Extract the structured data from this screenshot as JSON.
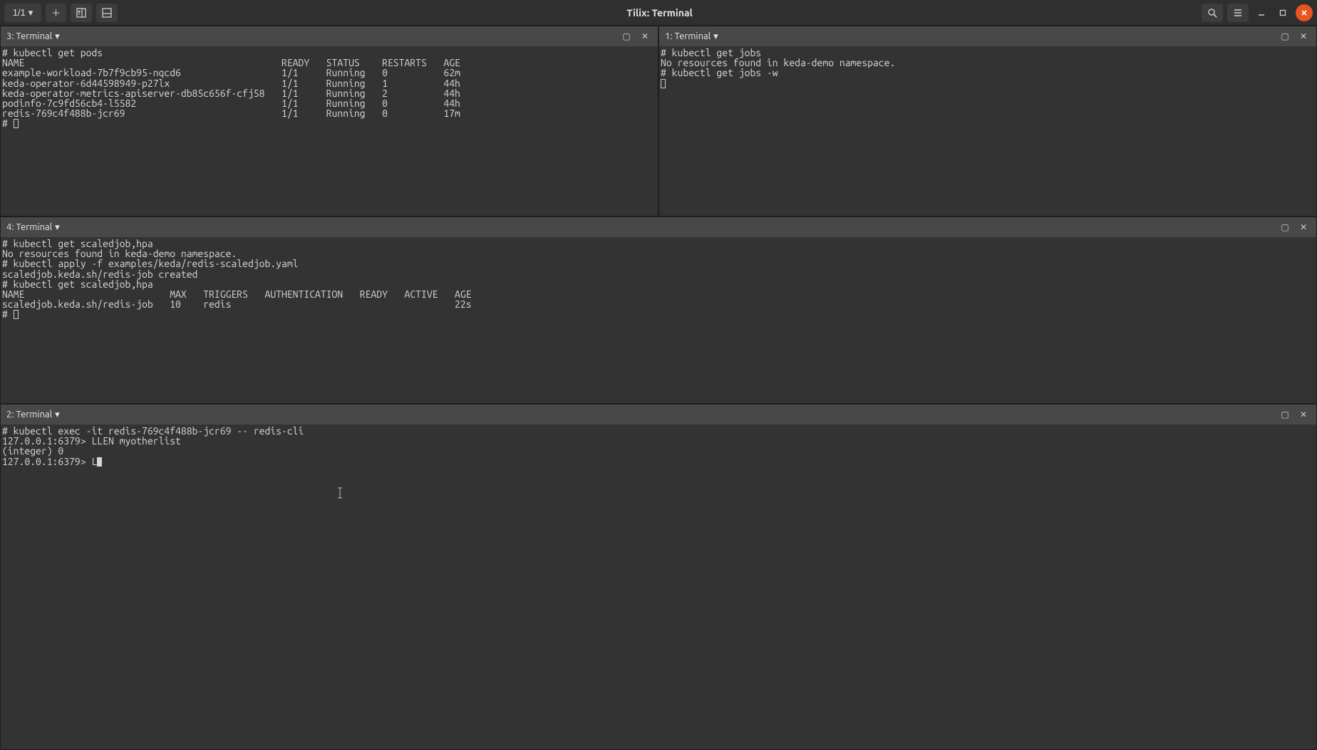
{
  "titlebar": {
    "session_label": "1/1",
    "title": "Tilix: Terminal"
  },
  "panes": {
    "p3": {
      "label": "3: Terminal"
    },
    "p1": {
      "label": "1: Terminal"
    },
    "p4": {
      "label": "4: Terminal"
    },
    "p2": {
      "label": "2: Terminal"
    }
  },
  "term3": {
    "cmd": "# kubectl get pods",
    "hdr": "NAME                                              READY   STATUS    RESTARTS   AGE",
    "r1": "example-workload-7b7f9cb95-nqcd6                  1/1     Running   0          62m",
    "r2": "keda-operator-6d44598949-p27lx                    1/1     Running   1          44h",
    "r3": "keda-operator-metrics-apiserver-db85c656f-cfj58   1/1     Running   2          44h",
    "r4": "podinfo-7c9fd56cb4-l5582                          1/1     Running   0          44h",
    "r5": "redis-769c4f488b-jcr69                            1/1     Running   0          17m",
    "prompt": "# "
  },
  "term1": {
    "l1": "# kubectl get jobs",
    "l2": "No resources found in keda-demo namespace.",
    "l3": "# kubectl get jobs -w"
  },
  "term4": {
    "l1": "# kubectl get scaledjob,hpa",
    "l2": "No resources found in keda-demo namespace.",
    "l3": "# kubectl apply -f examples/keda/redis-scaledjob.yaml",
    "l4": "scaledjob.keda.sh/redis-job created",
    "l5": "# kubectl get scaledjob,hpa",
    "l6": "NAME                          MAX   TRIGGERS   AUTHENTICATION   READY   ACTIVE   AGE",
    "l7": "scaledjob.keda.sh/redis-job   10    redis                                        22s",
    "prompt": "# "
  },
  "term2": {
    "l1": "# kubectl exec -it redis-769c4f488b-jcr69 -- redis-cli",
    "l2": "127.0.0.1:6379> LLEN myotherlist",
    "l3": "(integer) 0",
    "l4": "127.0.0.1:6379> L"
  }
}
